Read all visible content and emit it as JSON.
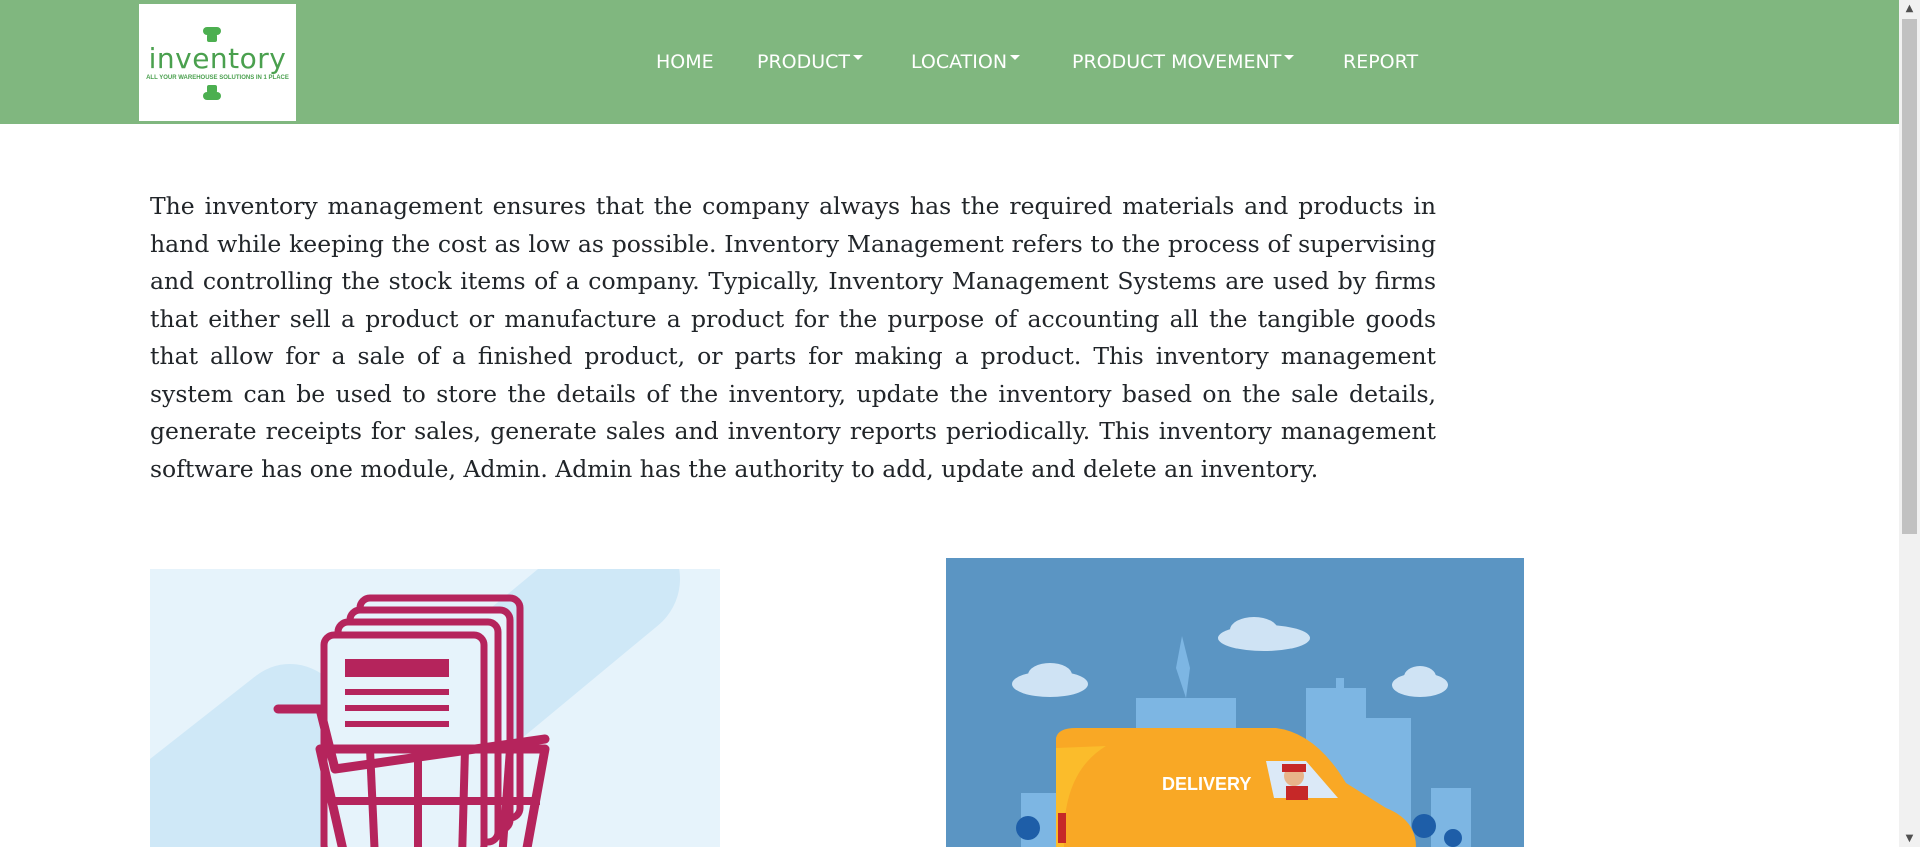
{
  "brand": {
    "name": "inventory",
    "tagline": "ALL YOUR WAREHOUSE SOLUTIONS IN 1 PLACE"
  },
  "nav": {
    "items": [
      {
        "label": "HOME",
        "dropdown": false
      },
      {
        "label": "PRODUCT",
        "dropdown": true
      },
      {
        "label": "LOCATION",
        "dropdown": true
      },
      {
        "label": "PRODUCT MOVEMENT",
        "dropdown": true
      },
      {
        "label": "REPORT",
        "dropdown": false
      }
    ]
  },
  "intro": {
    "text": "The inventory management ensures that the company always has the required materials and products in hand while keeping the cost as low as possible. Inventory Management refers to the process of supervising and controlling the stock items of a company. Typically, Inventory Management Systems are used by firms that either sell a product or manufacture a product for the purpose of accounting all the tangible goods that allow for a sale of a finished product, or parts for making a product. This inventory management system can be used to store the details of the inventory, update the inventory based on the sale details, generate receipts for sales, generate sales and inventory reports periodically. This inventory management software has one module, Admin. Admin has the authority to add, update and delete an inventory."
  },
  "images": {
    "delivery_label": "DELIVERY"
  },
  "colors": {
    "navbar": "#80b77f",
    "brand_green": "#4aa04e",
    "cart": "#b5245c",
    "van": "#f9a825",
    "sky": "#5b95c3"
  },
  "icons": {
    "cart": "shopping-cart-icon",
    "van": "delivery-van-icon"
  }
}
